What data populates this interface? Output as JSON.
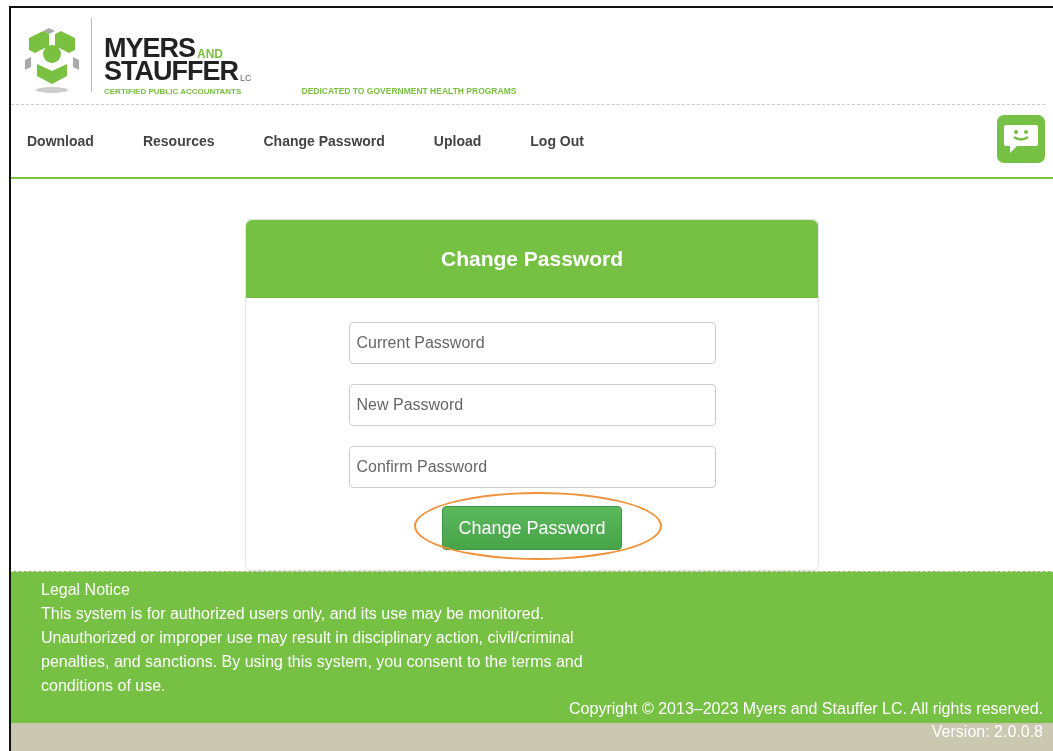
{
  "logo": {
    "name_top": "MYERS",
    "name_and": "AND",
    "name_bottom": "STAUFFER",
    "suffix": "LC",
    "subtitle": "CERTIFIED PUBLIC ACCOUNTANTS"
  },
  "tagline": "DEDICATED TO GOVERNMENT HEALTH PROGRAMS",
  "nav": [
    {
      "label": "Download"
    },
    {
      "label": "Resources"
    },
    {
      "label": "Change Password"
    },
    {
      "label": "Upload"
    },
    {
      "label": "Log Out"
    }
  ],
  "panel": {
    "title": "Change Password",
    "fields": [
      {
        "placeholder": "Current Password"
      },
      {
        "placeholder": "New Password"
      },
      {
        "placeholder": "Confirm Password"
      }
    ],
    "button": "Change Password",
    "button_highlighted": true
  },
  "footer": {
    "heading": "Legal Notice",
    "text": "This system is for authorized users only, and its use may be monitored. Unauthorized or improper use may result in disciplinary action, civil/criminal penalties, and sanctions. By using this system, you consent to the terms and conditions of use.",
    "copyright": "Copyright © 2013–2023 Myers and Stauffer LC. All rights reserved."
  },
  "version": "Version: 2.0.0.8"
}
